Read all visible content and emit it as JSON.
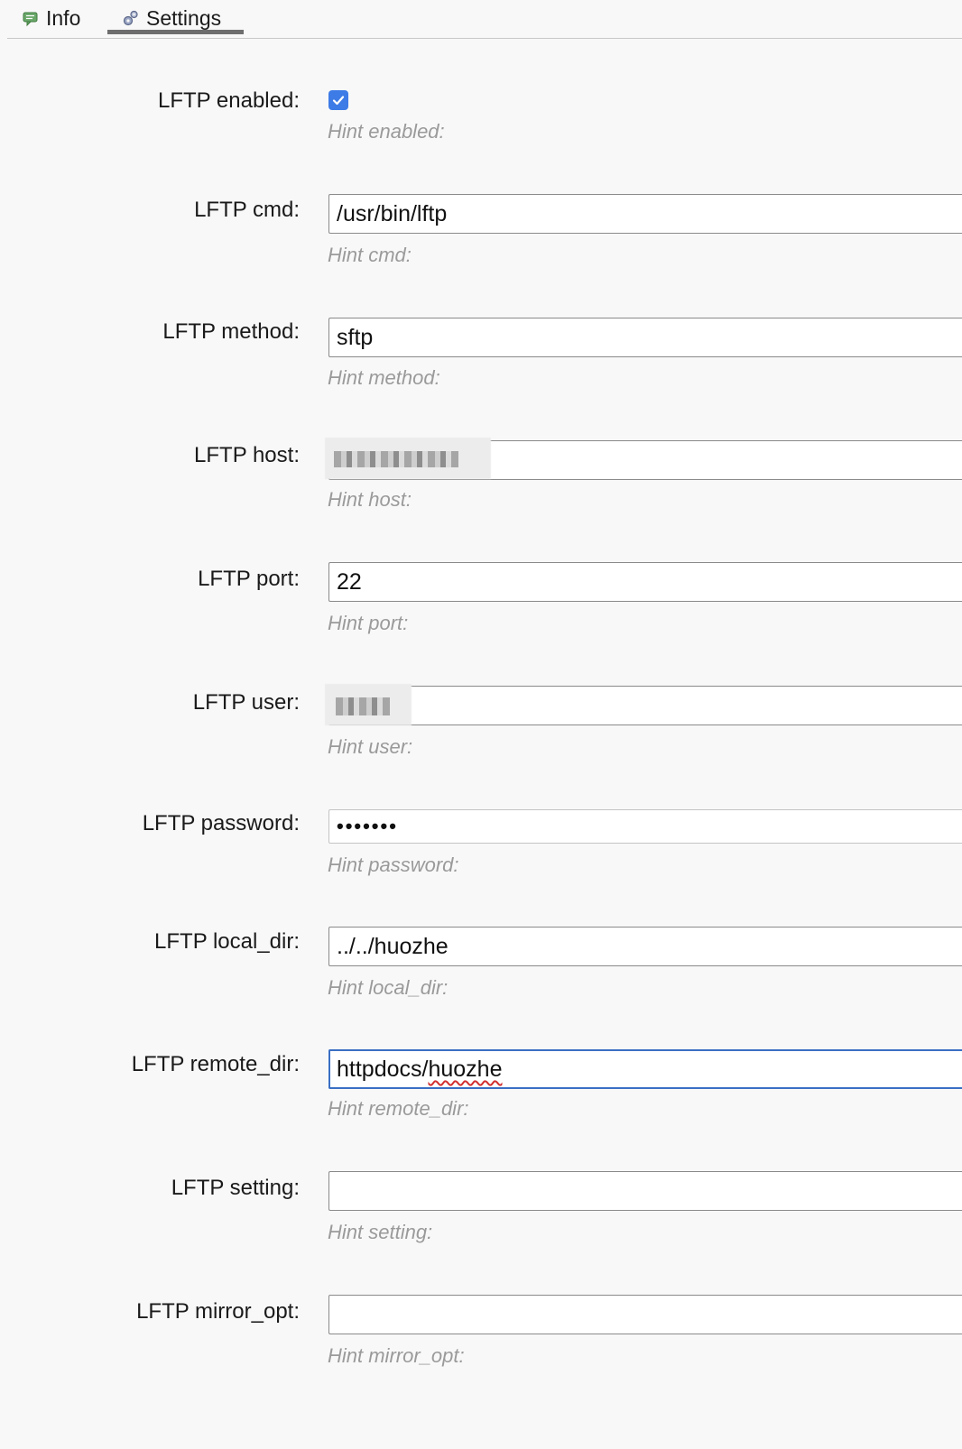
{
  "tabs": [
    {
      "label": "Info",
      "icon": "chat-bubble-icon",
      "active": false
    },
    {
      "label": "Settings",
      "icon": "gears-icon",
      "active": true
    }
  ],
  "form": {
    "enabled": {
      "label": "LFTP enabled:",
      "checked": true,
      "hint": "Hint enabled:"
    },
    "cmd": {
      "label": "LFTP cmd:",
      "value": "/usr/bin/lftp",
      "hint": "Hint cmd:"
    },
    "method": {
      "label": "LFTP method:",
      "value": "sftp",
      "hint": "Hint method:"
    },
    "host": {
      "label": "LFTP host:",
      "value": "",
      "hint": "Hint host:"
    },
    "port": {
      "label": "LFTP port:",
      "value": "22",
      "hint": "Hint port:"
    },
    "user": {
      "label": "LFTP user:",
      "value": "",
      "hint": "Hint user:"
    },
    "password": {
      "label": "LFTP password:",
      "value": "•••••••",
      "hint": "Hint password:"
    },
    "local_dir": {
      "label": "LFTP local_dir:",
      "value": "../../huozhe",
      "hint": "Hint local_dir:"
    },
    "remote_dir": {
      "label": "LFTP remote_dir:",
      "value_prefix": "httpdocs/",
      "value_spell": "huozhe",
      "hint": "Hint remote_dir:"
    },
    "setting": {
      "label": "LFTP setting:",
      "value": "",
      "hint": "Hint setting:"
    },
    "mirror_opt": {
      "label": "LFTP mirror_opt:",
      "value": "",
      "hint": "Hint mirror_opt:"
    }
  },
  "colors": {
    "checkbox": "#3d7be6",
    "focus_border": "#3a6fc4",
    "hint_text": "#9a9a9a",
    "background": "#f8f8f8"
  }
}
